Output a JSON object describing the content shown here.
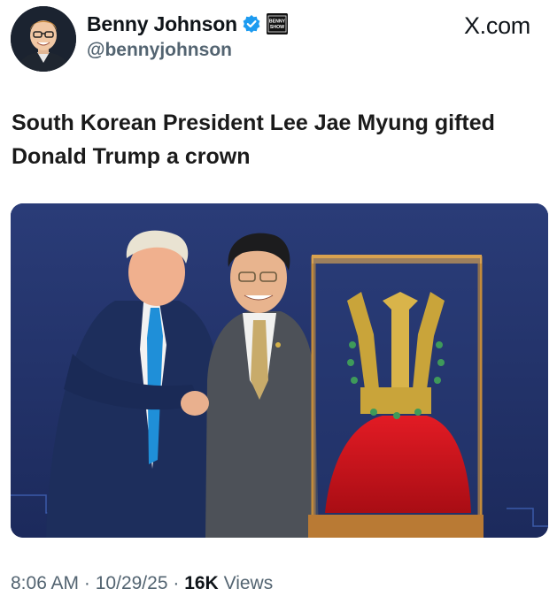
{
  "author": {
    "display_name": "Benny Johnson",
    "handle": "@bennyjohnson",
    "verified_color": "#1d9bf0",
    "badge_text": "BENNY\nSHOW",
    "avatar_icon": "profile-photo"
  },
  "site_label": "X.com",
  "post": {
    "text": "South Korean President Lee Jae Myung gifted Donald Trump a crown"
  },
  "media": {
    "type": "photo",
    "background_color": "#24356b",
    "accent_gold": "#c9a43a",
    "accent_red": "#d0121c"
  },
  "meta": {
    "time": "8:06 AM",
    "separator": "·",
    "date": "10/29/25",
    "views_count": "16K",
    "views_label": "Views"
  }
}
